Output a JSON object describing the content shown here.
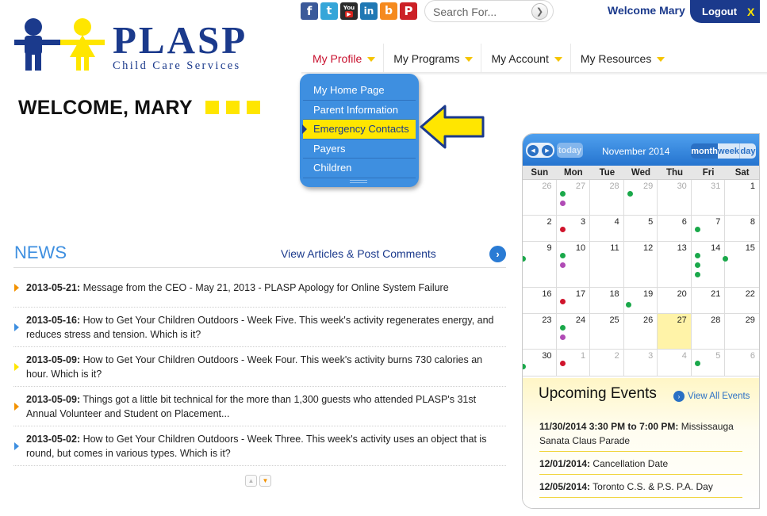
{
  "logo": {
    "name": "PLASP",
    "tagline": "Child Care Services"
  },
  "social": [
    "f",
    "t",
    "You",
    "in",
    "b",
    "P"
  ],
  "social_names": [
    "facebook-icon",
    "twitter-icon",
    "youtube-icon",
    "linkedin-icon",
    "blogger-icon",
    "pinterest-icon"
  ],
  "search": {
    "placeholder": "Search For..."
  },
  "header": {
    "welcome": "Welcome Mary",
    "logout": "Logout",
    "logout_x": "X"
  },
  "nav": [
    {
      "label": "My Profile",
      "active": true
    },
    {
      "label": "My Programs",
      "active": false
    },
    {
      "label": "My Account",
      "active": false
    },
    {
      "label": "My Resources",
      "active": false
    }
  ],
  "dropdown": [
    {
      "label": "My Home Page",
      "selected": false
    },
    {
      "label": "Parent Information",
      "selected": false
    },
    {
      "label": "Emergency Contacts",
      "selected": true
    },
    {
      "label": "Payers",
      "selected": false
    },
    {
      "label": "Children",
      "selected": false
    }
  ],
  "welcome_heading": "WELCOME, MARY",
  "news": {
    "title": "NEWS",
    "link": "View Articles & Post Comments",
    "items": [
      {
        "date": "2013-05-21:",
        "text": " Message from the CEO - May 21, 2013 - PLASP Apology for Online System Failure",
        "bullet": "orange"
      },
      {
        "date": "2013-05-16:",
        "text": " How to Get Your Children Outdoors - Week Five. This week's activity regenerates energy, and reduces stress and tension. Which is it?",
        "bullet": "blue"
      },
      {
        "date": "2013-05-09:",
        "text": " How to Get Your Children Outdoors - Week Four. This week's activity burns 730 calories an hour. Which is it?",
        "bullet": "yellow"
      },
      {
        "date": "2013-05-09:",
        "text": " Things got a little bit technical for the more than 1,300 guests who attended PLASP's 31st Annual Volunteer and Student on Placement...",
        "bullet": "orange"
      },
      {
        "date": "2013-05-02:",
        "text": " How to Get Your Children Outdoors - Week Three. This week's activity uses an object that is round, but comes in various types. Which is it?",
        "bullet": "blue"
      }
    ]
  },
  "calendar": {
    "today_label": "today",
    "month": "November 2014",
    "views": [
      "month",
      "week",
      "day"
    ],
    "days_of_week": [
      "Sun",
      "Mon",
      "Tue",
      "Wed",
      "Thu",
      "Fri",
      "Sat"
    ],
    "weeks": [
      [
        {
          "n": "26",
          "o": true
        },
        {
          "n": "27",
          "o": true,
          "dots": [
            "#1aa84a",
            "#b04bb5"
          ]
        },
        {
          "n": "28",
          "o": true
        },
        {
          "n": "29",
          "o": true,
          "dots": [
            "#1aa84a"
          ]
        },
        {
          "n": "30",
          "o": true
        },
        {
          "n": "31",
          "o": true
        },
        {
          "n": "1"
        }
      ],
      [
        {
          "n": "2"
        },
        {
          "n": "3",
          "dots": [
            "#d0142c"
          ]
        },
        {
          "n": "4"
        },
        {
          "n": "5"
        },
        {
          "n": "6"
        },
        {
          "n": "7",
          "dots": [
            "#1aa84a"
          ]
        },
        {
          "n": "8"
        }
      ],
      [
        {
          "n": "9",
          "dots": [
            "#1aa84a"
          ],
          "dotpos": "left"
        },
        {
          "n": "10",
          "dots": [
            "#1aa84a",
            "#b04bb5"
          ]
        },
        {
          "n": "11"
        },
        {
          "n": "12"
        },
        {
          "n": "13"
        },
        {
          "n": "14",
          "dots": [
            "#1aa84a",
            "#1aa84a",
            "#1aa84a"
          ]
        },
        {
          "n": "15",
          "dots": [
            "#1aa84a"
          ],
          "dotpos": "left"
        }
      ],
      [
        {
          "n": "16"
        },
        {
          "n": "17",
          "dots": [
            "#d0142c"
          ]
        },
        {
          "n": "18"
        },
        {
          "n": "19",
          "dots": [
            "#1aa84a"
          ],
          "dotpos": "bottom"
        },
        {
          "n": "20"
        },
        {
          "n": "21"
        },
        {
          "n": "22"
        }
      ],
      [
        {
          "n": "23"
        },
        {
          "n": "24",
          "dots": [
            "#1aa84a",
            "#b04bb5"
          ]
        },
        {
          "n": "25"
        },
        {
          "n": "26"
        },
        {
          "n": "27",
          "today": true
        },
        {
          "n": "28"
        },
        {
          "n": "29"
        }
      ],
      [
        {
          "n": "30",
          "dots": [
            "#1aa84a"
          ],
          "dotpos": "left"
        },
        {
          "n": "1",
          "o": true,
          "dots": [
            "#d0142c"
          ]
        },
        {
          "n": "2",
          "o": true
        },
        {
          "n": "3",
          "o": true
        },
        {
          "n": "4",
          "o": true
        },
        {
          "n": "5",
          "o": true,
          "dots": [
            "#1aa84a"
          ]
        },
        {
          "n": "6",
          "o": true
        }
      ]
    ]
  },
  "events": {
    "title": "Upcoming Events",
    "view_all": "View All Events",
    "items": [
      {
        "when": "11/30/2014 3:30 PM to 7:00 PM:",
        "what": " Mississauga Sanata Claus Parade"
      },
      {
        "when": "12/01/2014:",
        "what": " Cancellation Date"
      },
      {
        "when": "12/05/2014:",
        "what": " Toronto C.S. & P.S. P.A. Day"
      }
    ]
  },
  "colors": {
    "brand_blue": "#1b3a8c",
    "accent_blue": "#3e8fe0",
    "yellow": "#ffe600",
    "red": "#c8102e",
    "orange": "#f39200"
  }
}
